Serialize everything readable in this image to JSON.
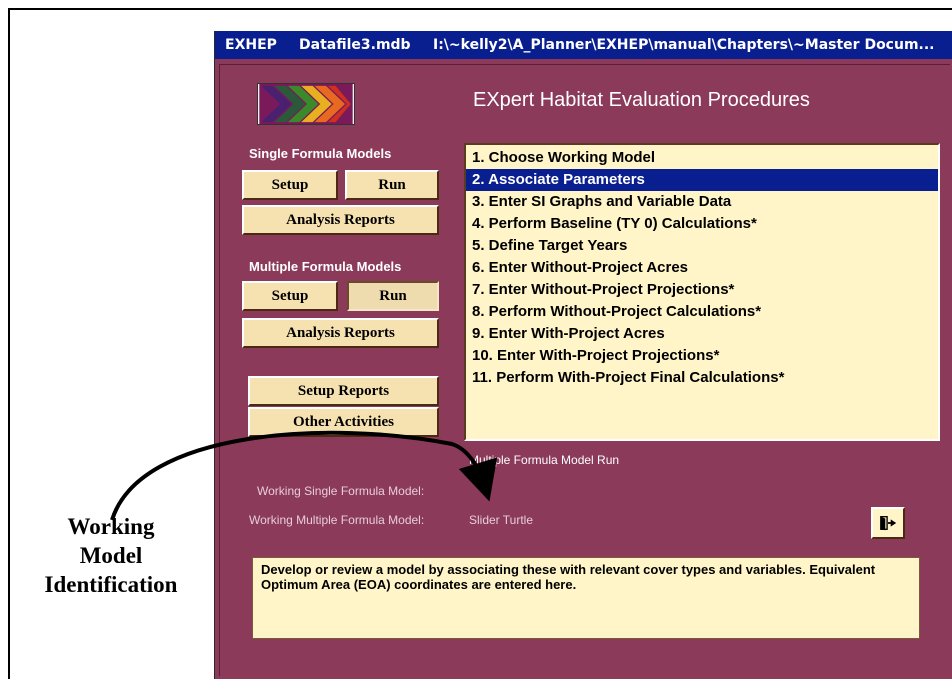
{
  "titlebar": {
    "app": "EXHEP",
    "file": "Datafile3.mdb",
    "path": "I:\\~kelly2\\A_Planner\\EXHEP\\manual\\Chapters\\~Master Docum..."
  },
  "app_title": "EXpert Habitat Evaluation Procedures",
  "single_formula": {
    "label": "Single Formula Models",
    "setup": "Setup",
    "run": "Run",
    "analysis_reports": "Analysis Reports"
  },
  "multiple_formula": {
    "label": "Multiple Formula Models",
    "setup": "Setup",
    "run": "Run",
    "analysis_reports": "Analysis Reports"
  },
  "setup_reports": "Setup Reports",
  "other_activities": "Other Activities",
  "steps": [
    {
      "label": "1. Choose Working Model"
    },
    {
      "label": "2. Associate Parameters",
      "selected": true
    },
    {
      "label": "3. Enter SI Graphs and Variable Data"
    },
    {
      "label": "4. Perform Baseline (TY 0) Calculations*"
    },
    {
      "label": "5. Define Target Years"
    },
    {
      "label": "6. Enter Without-Project Acres"
    },
    {
      "label": "7. Enter Without-Project Projections*"
    },
    {
      "label": "8. Perform Without-Project Calculations*"
    },
    {
      "label": "9. Enter With-Project Acres"
    },
    {
      "label": "10. Enter With-Project Projections*"
    },
    {
      "label": "11. Perform With-Project Final Calculations*"
    }
  ],
  "status": "Multiple Formula Model Run",
  "working_single_label": "Working Single Formula Model:",
  "working_single_value": "",
  "working_multiple_label": "Working Multiple Formula Model:",
  "working_multiple_value": "Slider Turtle",
  "description": "Develop or review a model by associating these with relevant cover types and variables.  Equivalent Optimum Area (EOA) coordinates are entered here.",
  "annotation": {
    "line1": "Working",
    "line2": "Model",
    "line3": "Identification"
  },
  "colors": {
    "window_bg": "#8b3a5a",
    "titlebar": "#0a1f8f",
    "button_face": "#f6e2b0",
    "list_bg": "#fff5c8",
    "selection": "#0a1f8f"
  },
  "icons": {
    "logo": "exhep-chevron-logo",
    "exit": "exit-door-icon"
  }
}
